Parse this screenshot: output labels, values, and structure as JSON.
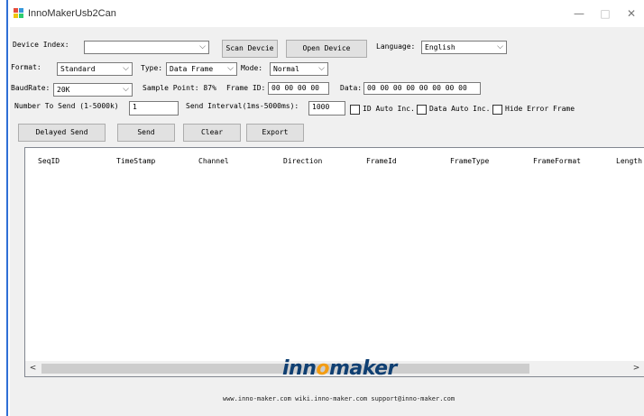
{
  "window": {
    "title": "InnoMakerUsb2Can",
    "minimize": "—",
    "maximize": "□",
    "close": "✕"
  },
  "device": {
    "index_label": "Device Index:",
    "index_value": "",
    "scan_button": "Scan Devcie",
    "open_button": "Open Device",
    "language_label": "Language:",
    "language_value": "English"
  },
  "frame": {
    "format_label": "Format:",
    "format_value": "Standard",
    "type_label": "Type:",
    "type_value": "Data Frame",
    "mode_label": "Mode:",
    "mode_value": "Normal"
  },
  "baud": {
    "baudrate_label": "BaudRate:",
    "baudrate_value": "20K",
    "sample_point": "Sample Point: 87%",
    "frame_id_label": "Frame ID:",
    "frame_id_value": "00 00 00 00",
    "data_label": "Data:",
    "data_value": "00 00 00 00 00 00 00 00"
  },
  "send": {
    "number_label": "Number To Send (1-5000k)",
    "number_value": "1",
    "interval_label": "Send Interval(1ms-5000ms):",
    "interval_value": "1000",
    "id_auto_inc": "ID Auto Inc.",
    "data_auto_inc": "Data Auto Inc.",
    "hide_error_frame": "Hide Error Frame"
  },
  "actions": {
    "delayed_send": "Delayed Send",
    "send": "Send",
    "clear": "Clear",
    "export": "Export"
  },
  "table": {
    "columns": [
      "SeqID",
      "TimeStamp",
      "Channel",
      "Direction",
      "FrameId",
      "FrameType",
      "FrameFormat",
      "Length"
    ],
    "rows": []
  },
  "scroll": {
    "left_arrow": "<",
    "right_arrow": ">"
  },
  "footer": {
    "logo_part1": "inn",
    "logo_o": "o",
    "logo_part2": "maker",
    "links": "www.inno-maker.com wiki.inno-maker.com support@inno-maker.com"
  },
  "colors": {
    "logo_blue": "#0f3f72",
    "logo_orange": "#f39c12",
    "window_border": "#2f6fd6"
  }
}
